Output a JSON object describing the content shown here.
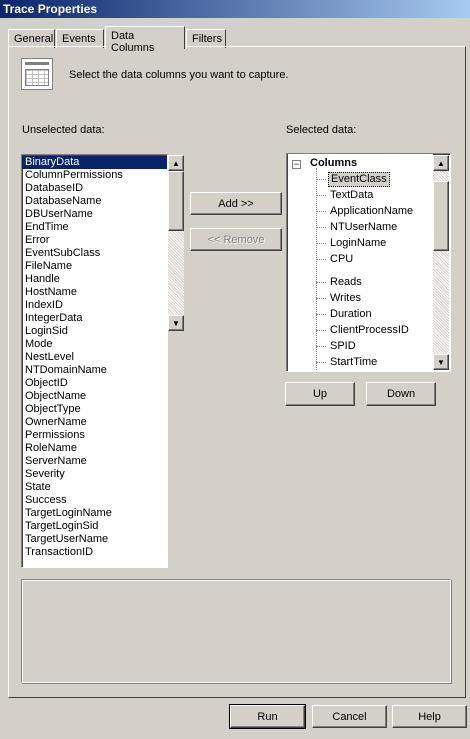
{
  "window": {
    "title": "Trace Properties"
  },
  "tabs": [
    {
      "label": "General"
    },
    {
      "label": "Events"
    },
    {
      "label": "Data Columns"
    },
    {
      "label": "Filters"
    }
  ],
  "instruction": "Select the data columns you want to capture.",
  "unselected": {
    "label": "Unselected data:",
    "items": [
      "BinaryData",
      "ColumnPermissions",
      "DatabaseID",
      "DatabaseName",
      "DBUserName",
      "EndTime",
      "Error",
      "EventSubClass",
      "FileName",
      "Handle",
      "HostName",
      "IndexID",
      "IntegerData",
      "LoginSid",
      "Mode",
      "NestLevel",
      "NTDomainName",
      "ObjectID",
      "ObjectName",
      "ObjectType",
      "OwnerName",
      "Permissions",
      "RoleName",
      "ServerName",
      "Severity",
      "State",
      "Success",
      "TargetLoginName",
      "TargetLoginSid",
      "TargetUserName",
      "TransactionID"
    ],
    "selected_item": "BinaryData"
  },
  "buttons": {
    "add": "Add >>",
    "remove": "<< Remove",
    "up": "Up",
    "down": "Down",
    "run": "Run",
    "cancel": "Cancel",
    "help": "Help"
  },
  "selected": {
    "label": "Selected data:",
    "root": "Columns",
    "items": [
      "EventClass",
      "TextData",
      "ApplicationName",
      "NTUserName",
      "LoginName",
      "CPU",
      "Reads",
      "Writes",
      "Duration",
      "ClientProcessID",
      "SPID",
      "StartTime"
    ],
    "selected_item": "EventClass"
  },
  "colors": {
    "titlebar_start": "#0a246a",
    "titlebar_end": "#a6caf0",
    "selection": "#0a246a",
    "face": "#d4d0c8"
  }
}
